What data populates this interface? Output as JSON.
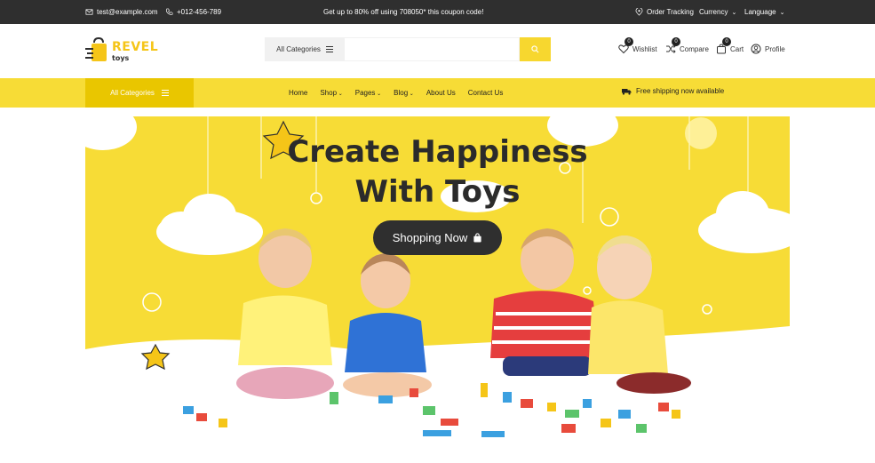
{
  "topbar": {
    "email": "test@example.com",
    "phone": "+012-456-789",
    "promo": "Get up to 80% off using 708050* this coupon code!",
    "order_tracking": "Order Tracking",
    "currency": "Currency",
    "language": "Language"
  },
  "header": {
    "brand": "REVEL",
    "brand_sub": "toys",
    "search_category": "All Categories",
    "search_placeholder": "",
    "wishlist_label": "Wishlist",
    "wishlist_count": "0",
    "compare_label": "Compare",
    "compare_count": "0",
    "cart_label": "Cart",
    "cart_count": "0",
    "profile_label": "Profile"
  },
  "nav": {
    "all_categories": "All Categories",
    "items": [
      "Home",
      "Shop",
      "Pages",
      "Blog",
      "About Us",
      "Contact Us"
    ],
    "free_shipping": "Free shipping now available"
  },
  "hero": {
    "title_line1": "Create Happiness",
    "title_line2": "With Toys",
    "cta": "Shopping Now"
  },
  "colors": {
    "accent_yellow": "#f7dc36",
    "dark": "#2f2f2f"
  }
}
